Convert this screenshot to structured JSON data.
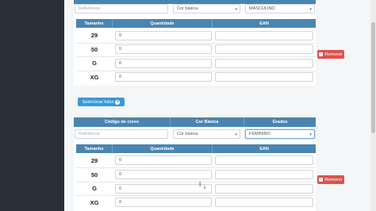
{
  "block1": {
    "reference_placeholder": "Referência",
    "color_select": "Cor básica",
    "gender_select": "MASCULINO",
    "table_headers": {
      "size": "Tamanho",
      "quantity": "Quantidade",
      "ean": "EAN"
    },
    "rows": [
      {
        "size": "29",
        "quantity": "0",
        "ean": ""
      },
      {
        "size": "50",
        "quantity": "0",
        "ean": ""
      },
      {
        "size": "G",
        "quantity": "0",
        "ean": ""
      },
      {
        "size": "XG",
        "quantity": "0",
        "ean": ""
      }
    ],
    "remove_label": "Remover",
    "photos_label": "Selecionar fotos"
  },
  "block2": {
    "headers": {
      "color_code": "Código de cores",
      "basic_color": "Cor Básica",
      "grades": "Grades"
    },
    "reference_placeholder": "Referência",
    "color_select": "Cor básica",
    "gender_select": "FEMININO",
    "table_headers": {
      "size": "Tamanho",
      "quantity": "Quantidade",
      "ean": "EAN"
    },
    "rows": [
      {
        "size": "29",
        "quantity": "0",
        "ean": ""
      },
      {
        "size": "50",
        "quantity": "0",
        "ean": ""
      },
      {
        "size": "G",
        "quantity": "0",
        "ean": ""
      },
      {
        "size": "XG",
        "quantity": "0",
        "ean": ""
      }
    ],
    "remove_label": "Remover"
  },
  "icons": {
    "remove": "minus-square-icon",
    "photos": "plus-circle-icon",
    "dropdown": "chevron-down-icon"
  },
  "colors": {
    "header_blue": "#4a85b0",
    "remove_red": "#d9534f",
    "photos_blue": "#3a9ad9",
    "sidebar": "#2a3038"
  }
}
